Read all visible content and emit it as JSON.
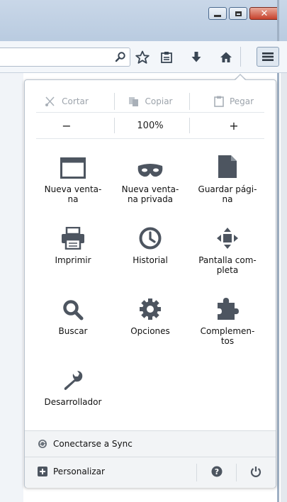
{
  "toolbar": {
    "icons": [
      "search-icon",
      "bookmark-star-icon",
      "reading-list-icon",
      "download-icon",
      "home-icon",
      "hamburger-menu-icon"
    ]
  },
  "panel": {
    "edit": {
      "cut": "Cortar",
      "copy": "Copiar",
      "paste": "Pegar"
    },
    "zoom": {
      "out": "−",
      "level": "100%",
      "in": "+"
    },
    "items": [
      {
        "label": "Nueva venta-\nna",
        "icon": "new-window-icon"
      },
      {
        "label": "Nueva venta-\nna privada",
        "icon": "private-mask-icon"
      },
      {
        "label": "Guardar pági-\nna",
        "icon": "save-page-icon"
      },
      {
        "label": "Imprimir",
        "icon": "printer-icon"
      },
      {
        "label": "Historial",
        "icon": "clock-icon"
      },
      {
        "label": "Pantalla com-\npleta",
        "icon": "fullscreen-icon"
      },
      {
        "label": "Buscar",
        "icon": "magnifier-icon"
      },
      {
        "label": "Opciones",
        "icon": "gear-icon"
      },
      {
        "label": "Complemen-\ntos",
        "icon": "puzzle-icon"
      },
      {
        "label": "Desarrollador",
        "icon": "wrench-icon"
      }
    ],
    "sync": {
      "label": "Conectarse a Sync"
    },
    "customize": {
      "label": "Personalizar"
    }
  },
  "colors": {
    "icon": "#4d5560",
    "accent": "#2c5d9a",
    "panel_footer": "#f2f4f6"
  }
}
